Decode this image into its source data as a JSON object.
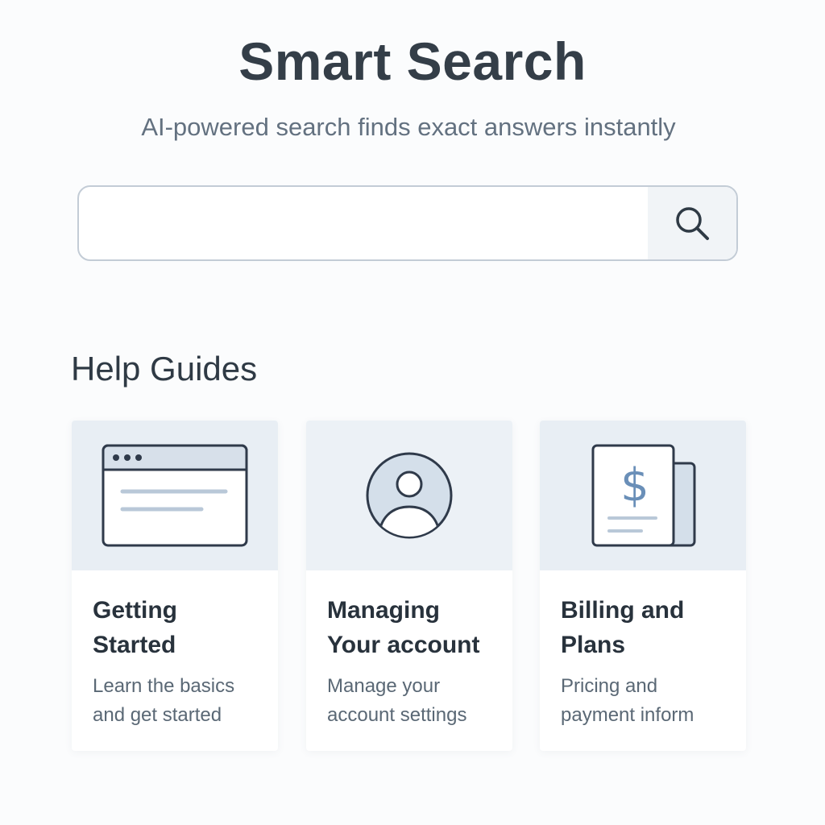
{
  "header": {
    "title": "Smart Search",
    "subtitle": "AI-powered search finds exact answers instantly"
  },
  "search": {
    "value": "",
    "placeholder": "",
    "button_icon": "search-icon"
  },
  "help": {
    "heading": "Help Guides",
    "cards": [
      {
        "icon": "browser-window-icon",
        "title_line1": "Getting",
        "title_line2": "Started",
        "desc": "Learn the basics\nand get started"
      },
      {
        "icon": "user-avatar-icon",
        "title_line1": "Managing",
        "title_line2": "Your account",
        "desc": "Manage your\naccount settings"
      },
      {
        "icon": "billing-document-icon",
        "title_line1": "Billing and",
        "title_line2": "Plans",
        "desc": "Pricing and\npayment inform"
      }
    ]
  },
  "colors": {
    "background": "#fbfcfd",
    "art_background": "#e8eef4",
    "icon_stroke": "#2f3a4a",
    "accent_blue": "#6a8fb8"
  }
}
